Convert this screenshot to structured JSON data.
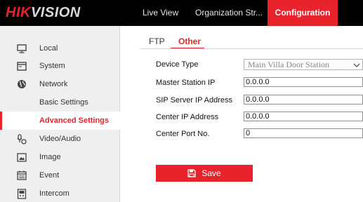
{
  "topbar": {
    "logo_part1": "HIK",
    "logo_part2": "VISION",
    "nav": [
      {
        "label": "Live View"
      },
      {
        "label": "Organization Str..."
      },
      {
        "label": "Configuration"
      }
    ]
  },
  "sidebar": {
    "items": [
      {
        "label": "Local",
        "icon": "monitor-icon"
      },
      {
        "label": "System",
        "icon": "system-window-icon"
      },
      {
        "label": "Network",
        "icon": "globe-icon"
      },
      {
        "label": "Basic Settings"
      },
      {
        "label": "Advanced Settings",
        "active": true
      },
      {
        "label": "Video/Audio",
        "icon": "microphone-camera-icon"
      },
      {
        "label": "Image",
        "icon": "image-icon"
      },
      {
        "label": "Event",
        "icon": "calendar-icon"
      },
      {
        "label": "Intercom",
        "icon": "intercom-panel-icon"
      }
    ]
  },
  "tabs": [
    {
      "label": "FTP"
    },
    {
      "label": "Other",
      "active": true
    }
  ],
  "form": {
    "device_type": {
      "label": "Device Type",
      "value": "Main Villa Door Station"
    },
    "master_station_ip": {
      "label": "Master Station IP",
      "value": "0.0.0.0"
    },
    "sip_server_ip": {
      "label": "SIP Server IP Address",
      "value": "0.0.0.0"
    },
    "center_ip": {
      "label": "Center IP Address",
      "value": "0.0.0.0"
    },
    "center_port": {
      "label": "Center Port No.",
      "value": "0"
    }
  },
  "save_button": {
    "label": "Save",
    "icon": "floppy-disk-icon"
  },
  "colors": {
    "accent": "#e8232c",
    "topbar": "#000000",
    "sidebar": "#efefef"
  }
}
